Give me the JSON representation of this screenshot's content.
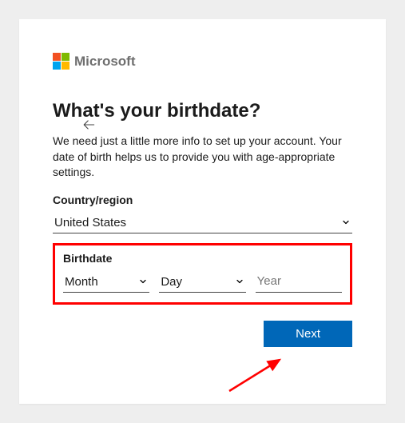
{
  "brand": {
    "name": "Microsoft"
  },
  "heading": "What's your birthdate?",
  "description": "We need just a little more info to set up your account. Your date of birth helps us to provide you with age-appropriate settings.",
  "country": {
    "label": "Country/region",
    "value": "United States"
  },
  "birthdate": {
    "label": "Birthdate",
    "month_placeholder": "Month",
    "day_placeholder": "Day",
    "year_placeholder": "Year"
  },
  "next_label": "Next",
  "colors": {
    "accent": "#0067b8",
    "highlight": "#ff0000"
  }
}
